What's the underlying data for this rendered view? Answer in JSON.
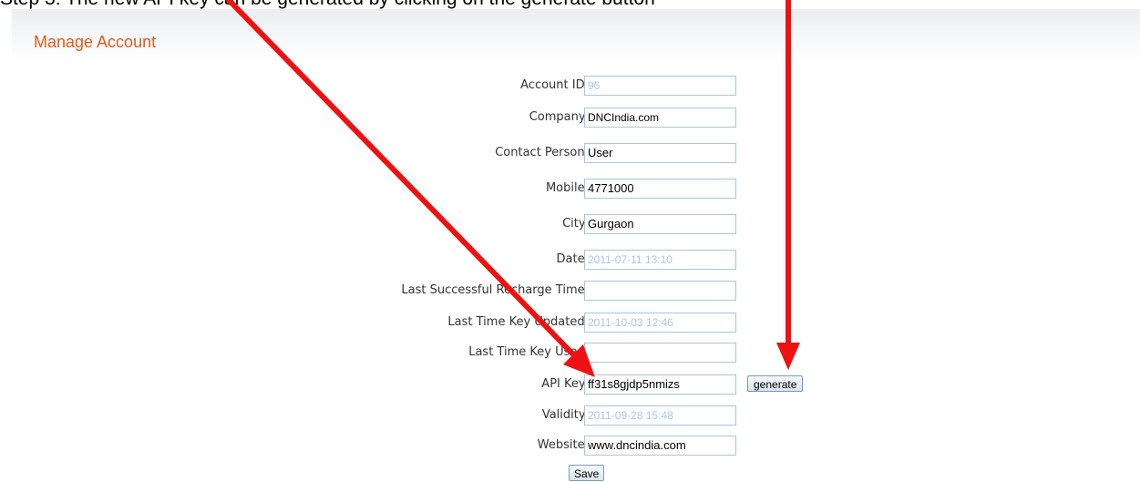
{
  "caption": "Step 3: The new API key can be generated by clicking on the generate button",
  "panel": {
    "title": "Manage Account"
  },
  "form": {
    "account_id": {
      "label": "Account ID:",
      "value": "96"
    },
    "company": {
      "label": "Company:",
      "value": "DNCIndia.com"
    },
    "contact_person": {
      "label": "Contact Person:",
      "value": "User"
    },
    "mobile": {
      "label": "Mobile:",
      "value": "4771000"
    },
    "city": {
      "label": "City:",
      "value": "Gurgaon"
    },
    "date": {
      "label": "Date:",
      "value": "2011-07-11 13:10"
    },
    "last_recharge": {
      "label": "Last Successful Recharge Time:",
      "value": ""
    },
    "last_key_updated": {
      "label": "Last Time Key Updated:",
      "value": "2011-10-03 12:46"
    },
    "last_key_used": {
      "label": "Last Time Key Used:",
      "value": ""
    },
    "api_key": {
      "label": "API Key:",
      "value": "ff31s8gjdp5nmizs"
    },
    "validity": {
      "label": "Validity:",
      "value": "2011-09-28 15:48"
    },
    "website": {
      "label": "Website:",
      "value": "www.dncindia.com"
    }
  },
  "buttons": {
    "generate_label": "generate",
    "save_label": "Save"
  },
  "annotation": {
    "arrow_color": "#ee1111"
  },
  "colors": {
    "title": "#e8591a",
    "field_border": "#a7c6df",
    "disabled_text": "#a9c8e6"
  }
}
